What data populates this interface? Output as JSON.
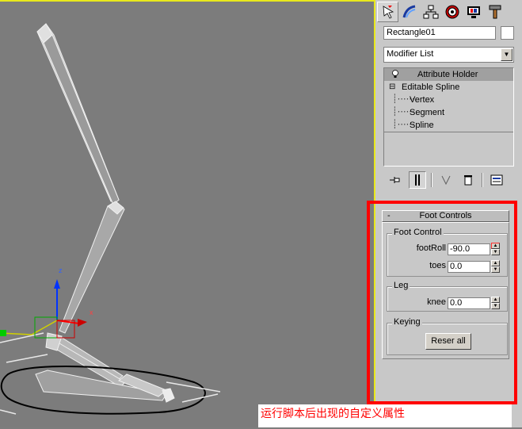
{
  "viewport": {
    "axis_labels": {
      "z": "z",
      "x": "x"
    }
  },
  "command_panel": {
    "tabs": [
      {
        "icon": "create-icon",
        "active": true
      },
      {
        "icon": "modify-icon",
        "active": false
      },
      {
        "icon": "hierarchy-icon",
        "active": false
      },
      {
        "icon": "motion-icon",
        "active": false
      },
      {
        "icon": "display-icon",
        "active": false
      },
      {
        "icon": "utilities-icon",
        "active": false
      }
    ],
    "object_name": "Rectangle01",
    "modifier_list": "Modifier List",
    "stack": [
      {
        "label": "Attribute Holder",
        "selected": true
      },
      {
        "label": "Editable Spline",
        "selected": false
      },
      {
        "label": "Vertex",
        "selected": false
      },
      {
        "label": "Segment",
        "selected": false
      },
      {
        "label": "Spline",
        "selected": false
      }
    ],
    "stack_expand": "⊟"
  },
  "rollout": {
    "collapse": "-",
    "title": "Foot Controls",
    "foot_control": {
      "title": "Foot Control",
      "footroll_label": "footRoll",
      "footroll_value": "-90.0",
      "toes_label": "toes",
      "toes_value": "0.0"
    },
    "leg": {
      "title": "Leg",
      "knee_label": "knee",
      "knee_value": "0.0"
    },
    "keying": {
      "title": "Keying",
      "reset_label": "Reser all"
    }
  },
  "caption": "运行脚本后出现的自定义属性",
  "colors": {
    "highlight": "#ff0000",
    "viewport_border": "#e8e81c"
  }
}
